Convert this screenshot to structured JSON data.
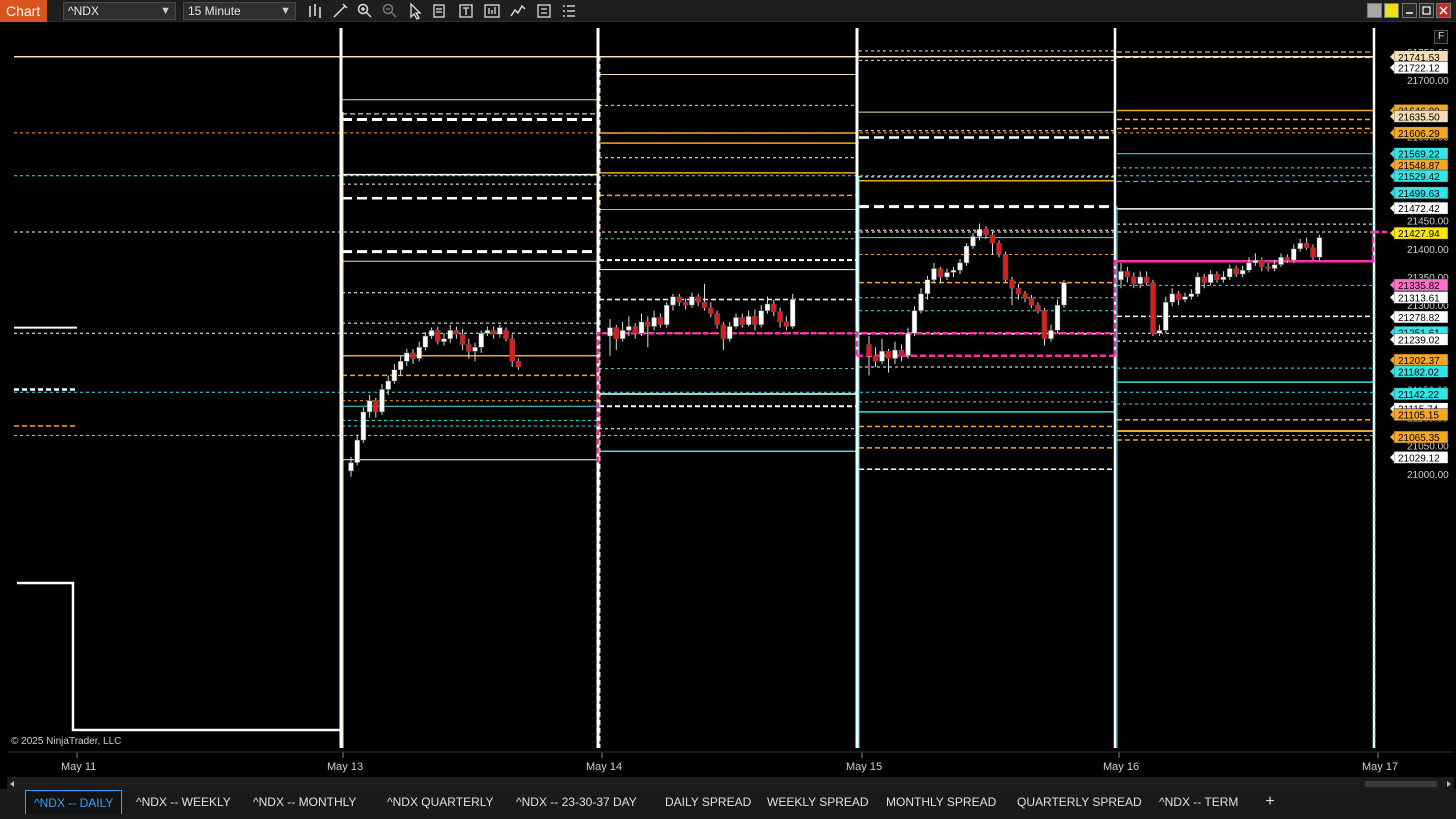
{
  "app": {
    "label": "Chart"
  },
  "toolbar": {
    "instrument": "^NDX",
    "period": "15 Minute",
    "tools": [
      "bar-type-icon",
      "drawing-tool-icon",
      "zoom-in-icon",
      "zoom-out-icon",
      "pointer-icon",
      "data-box-icon",
      "properties-icon",
      "strategies-icon",
      "indicators-icon",
      "templates-icon"
    ],
    "window_colors": [
      "#a7a7a7",
      "#f0e21a"
    ]
  },
  "chart": {
    "f_button": "F",
    "copyright": "© 2025 NinjaTrader, LLC",
    "date_labels": [
      {
        "text": "May 11"
      },
      {
        "text": "May 13"
      },
      {
        "text": "May 14"
      },
      {
        "text": "May 15"
      },
      {
        "text": "May 16"
      },
      {
        "text": "May 17"
      }
    ],
    "axis_ticks": [
      "21750.00",
      "21700.00",
      "21650.00",
      "21600.00",
      "21550.00",
      "21500.00",
      "21450.00",
      "21400.00",
      "21350.00",
      "21300.00",
      "21250.00",
      "21200.00",
      "21150.00",
      "21100.00",
      "21050.00",
      "21000.00"
    ],
    "price_badges": [
      {
        "text": "21741.53",
        "color": "#f5deb3"
      },
      {
        "text": "21722.12",
        "color": "#ffffff"
      },
      {
        "text": "21646.09",
        "color": "#f5a623"
      },
      {
        "text": "21635.50",
        "color": "#f5deb3"
      },
      {
        "text": "21606.29",
        "color": "#f5a623"
      },
      {
        "text": "21569.22",
        "color": "#35e5e5"
      },
      {
        "text": "21548.87",
        "color": "#f5a623"
      },
      {
        "text": "21529.42",
        "color": "#35e5e5"
      },
      {
        "text": "21499.63",
        "color": "#35e5e5"
      },
      {
        "text": "21472.42",
        "color": "#ffffff"
      },
      {
        "text": "21427.94",
        "color": "#ffe80a"
      },
      {
        "text": "21335.82",
        "color": "#ff6ec7"
      },
      {
        "text": "21313.61",
        "color": "#ffffff"
      },
      {
        "text": "21278.82",
        "color": "#ffffff"
      },
      {
        "text": "21251.61",
        "color": "#35e5e5"
      },
      {
        "text": "21239.02",
        "color": "#ffffff"
      },
      {
        "text": "21202.37",
        "color": "#f5a623"
      },
      {
        "text": "21182.02",
        "color": "#35e5e5"
      },
      {
        "text": "21142.22",
        "color": "#35e5e5"
      },
      {
        "text": "21115.74",
        "color": "#ffffff"
      },
      {
        "text": "21105.15",
        "color": "#f5a623"
      },
      {
        "text": "21065.35",
        "color": "#f5a623"
      },
      {
        "text": "21029.12",
        "color": "#ffffff"
      }
    ]
  },
  "tabs": [
    {
      "label": "^NDX -- DAILY",
      "active": true
    },
    {
      "label": "^NDX -- WEEKLY"
    },
    {
      "label": "^NDX -- MONTHLY"
    },
    {
      "label": "^NDX QUARTERLY"
    },
    {
      "label": "^NDX -- 23-30-37 DAY"
    },
    {
      "label": "DAILY SPREAD"
    },
    {
      "label": "WEEKLY SPREAD"
    },
    {
      "label": "MONTHLY SPREAD"
    },
    {
      "label": "QUARTERLY SPREAD"
    },
    {
      "label": "^NDX -- TERM"
    }
  ],
  "add_tab": "+"
}
